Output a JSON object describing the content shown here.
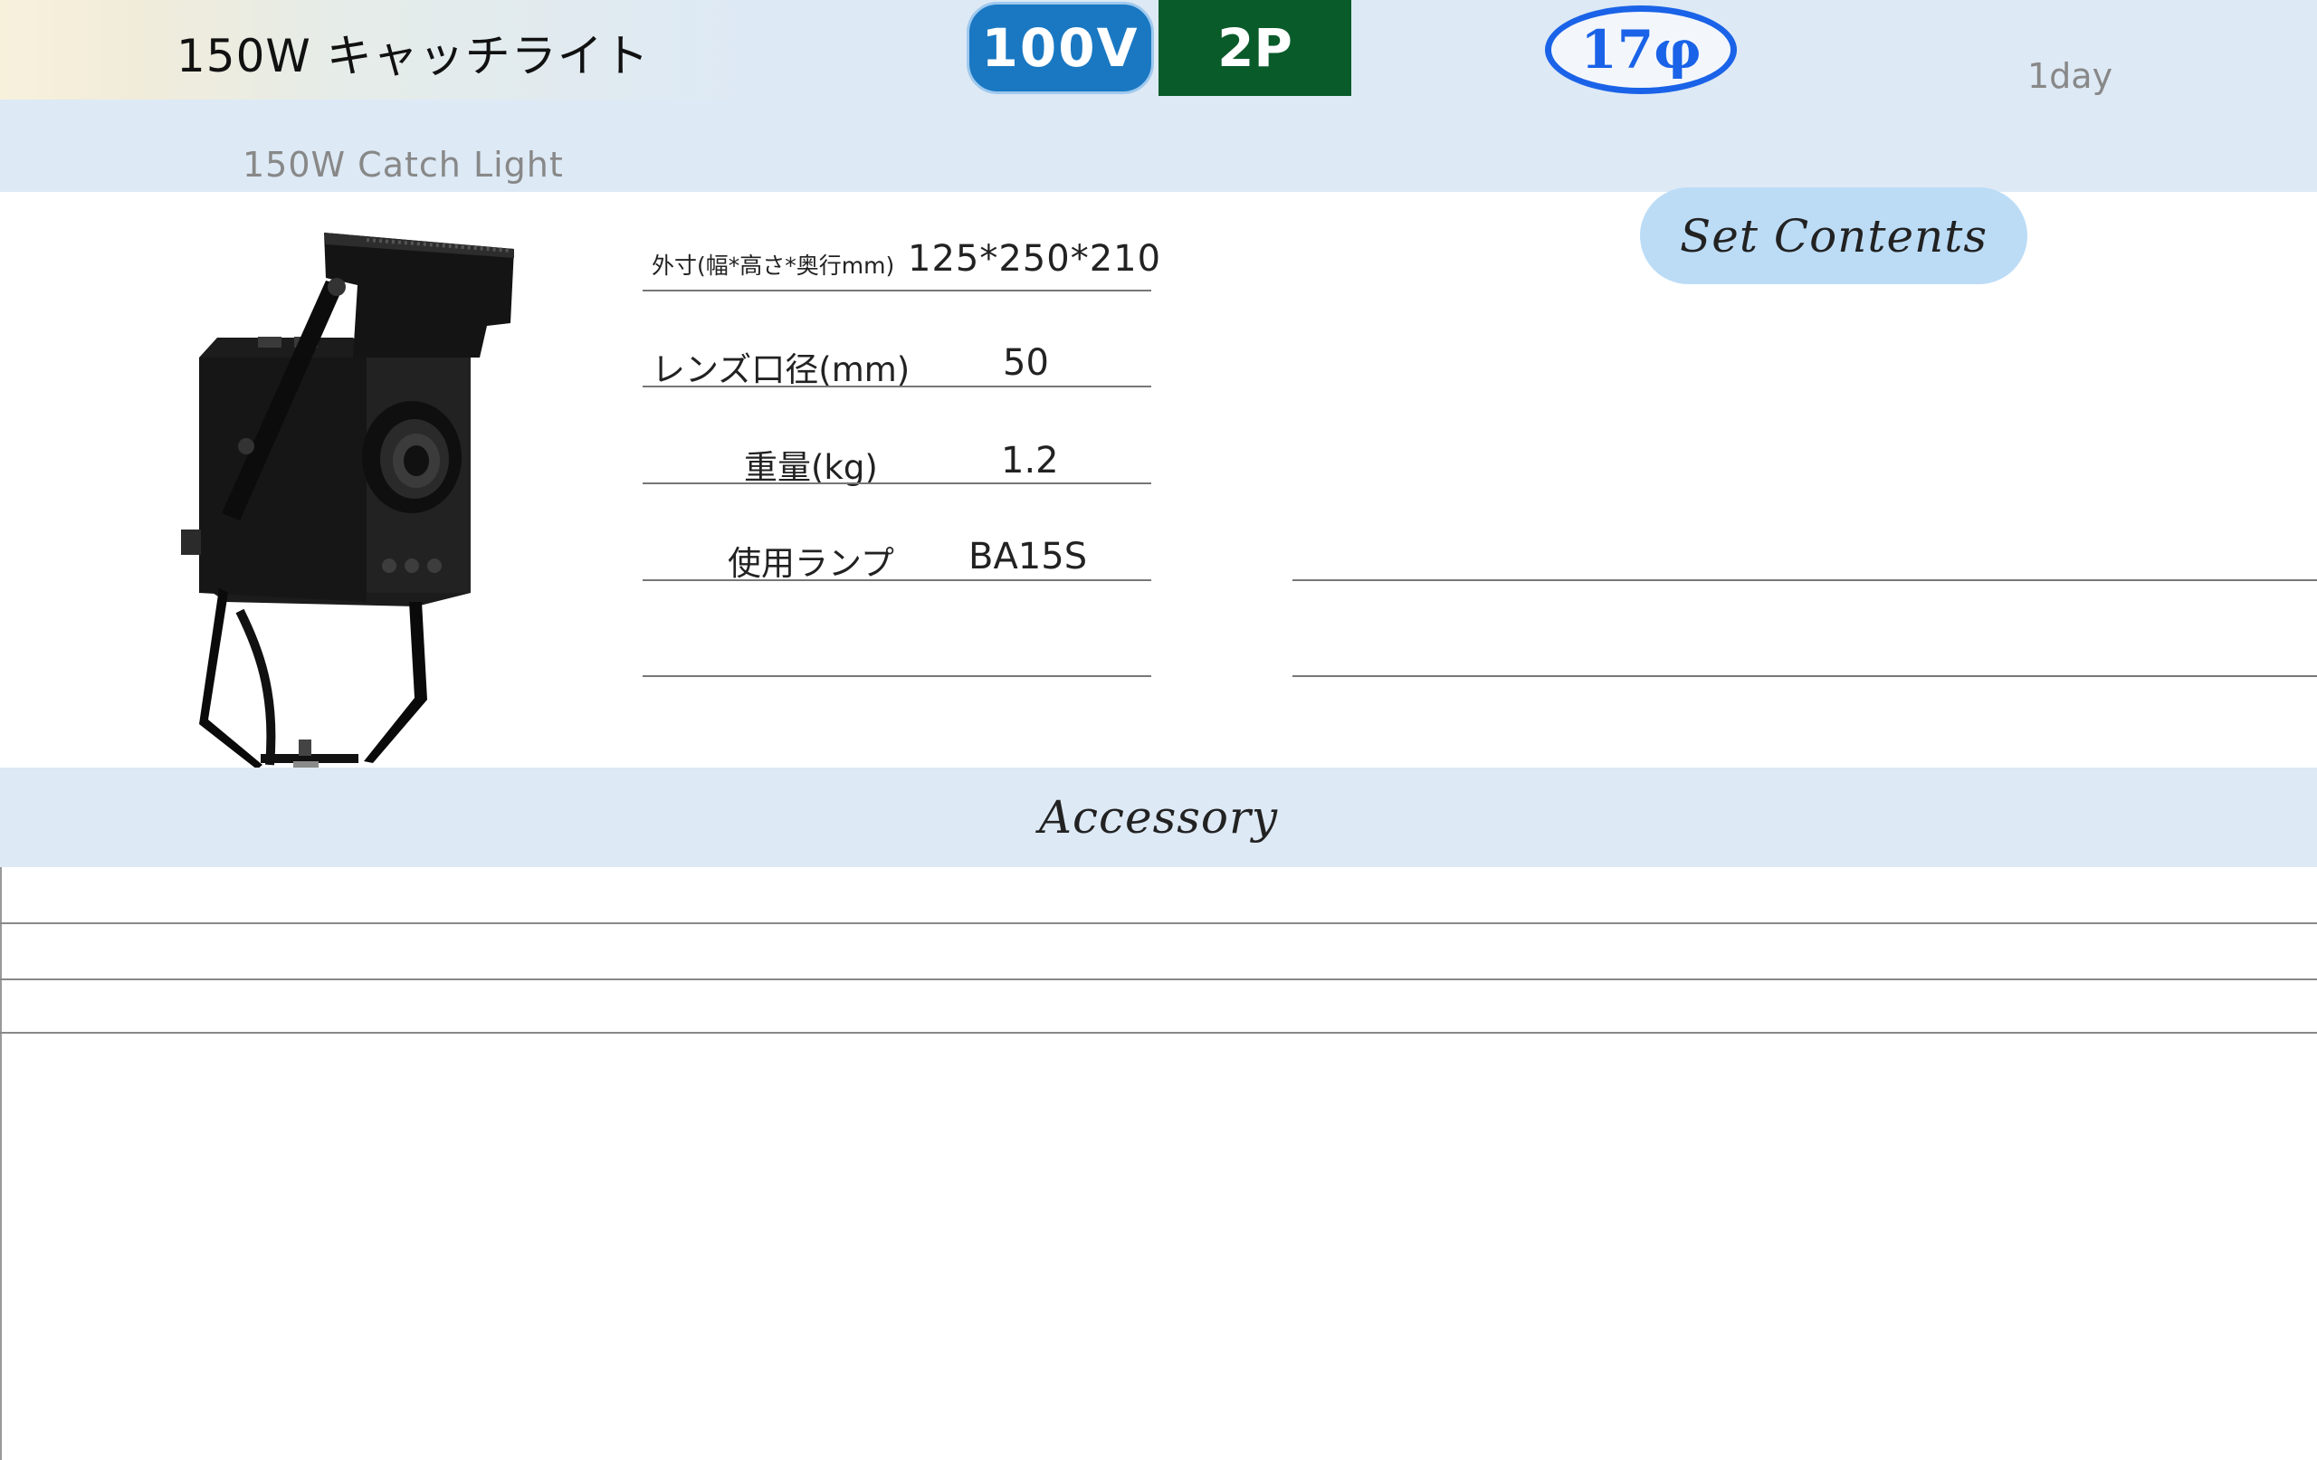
{
  "header": {
    "title": "150W キャッチライト",
    "subtitle": "150W Catch Light",
    "badges": {
      "voltage": "100V",
      "plug": "2P",
      "diameter": "17φ"
    },
    "rental_period": "1day"
  },
  "specs": {
    "dimensions": {
      "label": "外寸(幅*高さ*奥行mm)",
      "value": "125*250*210"
    },
    "lens_diameter": {
      "label": "レンズ口径(mm)",
      "value": "50"
    },
    "weight": {
      "label": "重量(kg)",
      "value": "1.2"
    },
    "lamp": {
      "label": "使用ランプ",
      "value": "BA15S"
    }
  },
  "set_contents": {
    "title": "Set Contents"
  },
  "accessory": {
    "title": "Accessory"
  },
  "colors": {
    "header_bg": "#dde9f5",
    "voltage_badge": "#1a78c2",
    "plug_badge": "#0a5b2a",
    "diameter_ring": "#1a63e8",
    "set_contents_pill": "#bcdcf6"
  },
  "image": {
    "product_icon": "catch-light-photo"
  }
}
